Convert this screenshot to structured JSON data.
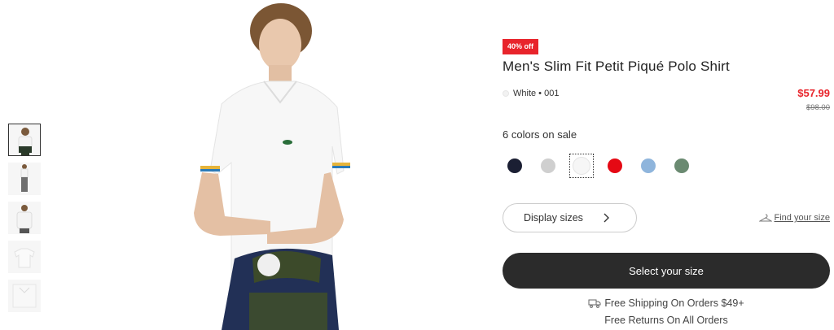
{
  "product": {
    "discount_badge": "40% off",
    "title": "Men's Slim Fit Petit Piqué Polo Shirt",
    "color_name": "White • 001",
    "price_now": "$57.99",
    "price_was": "$98.00",
    "colors_label": "6 colors on sale",
    "swatches": [
      {
        "name": "navy",
        "color": "#1b1f33"
      },
      {
        "name": "grey",
        "color": "#cfcfcf"
      },
      {
        "name": "white",
        "color": "#f6f6f6",
        "selected": true
      },
      {
        "name": "red",
        "color": "#e50914"
      },
      {
        "name": "light-blue",
        "color": "#8fb5dc"
      },
      {
        "name": "green",
        "color": "#6a8a71"
      }
    ]
  },
  "actions": {
    "display_sizes": "Display sizes",
    "find_your_size": "Find your size",
    "select_size": "Select your size"
  },
  "info": {
    "shipping": "Free Shipping On Orders $49+",
    "returns": "Free Returns On All Orders"
  },
  "icons": {
    "chevron": "chevron-right-icon",
    "hanger": "hanger-icon",
    "truck": "truck-icon"
  },
  "colors": {
    "accent_red": "#e8242b",
    "button_dark": "#2b2b2b"
  }
}
